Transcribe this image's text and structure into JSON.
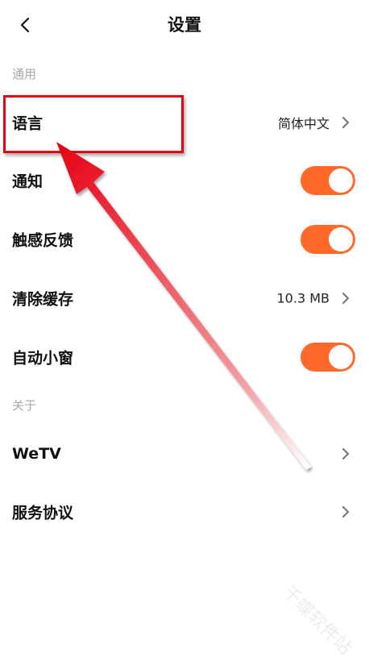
{
  "header": {
    "back_icon": "chevron-left-icon",
    "title": "设置"
  },
  "sections": {
    "general_label": "通用",
    "about_label": "关于"
  },
  "rows": {
    "language": {
      "label": "语言",
      "value": "简体中文"
    },
    "notifications": {
      "label": "通知",
      "toggle_on": true
    },
    "haptic": {
      "label": "触感反馈",
      "toggle_on": true
    },
    "clear_cache": {
      "label": "清除缓存",
      "value": "10.3 MB"
    },
    "mini_window": {
      "label": "自动小窗",
      "toggle_on": true
    },
    "wetv": {
      "label": "WeTV"
    },
    "service_agreement": {
      "label": "服务协议"
    }
  },
  "annotation": {
    "highlight_color": "#e60012",
    "highlight_target": "language"
  },
  "watermark_text": "千蝶软件站",
  "colors": {
    "accent": "#ff6a2b",
    "section_label": "#a8a8a8",
    "chevron": "#7a7a7a"
  }
}
